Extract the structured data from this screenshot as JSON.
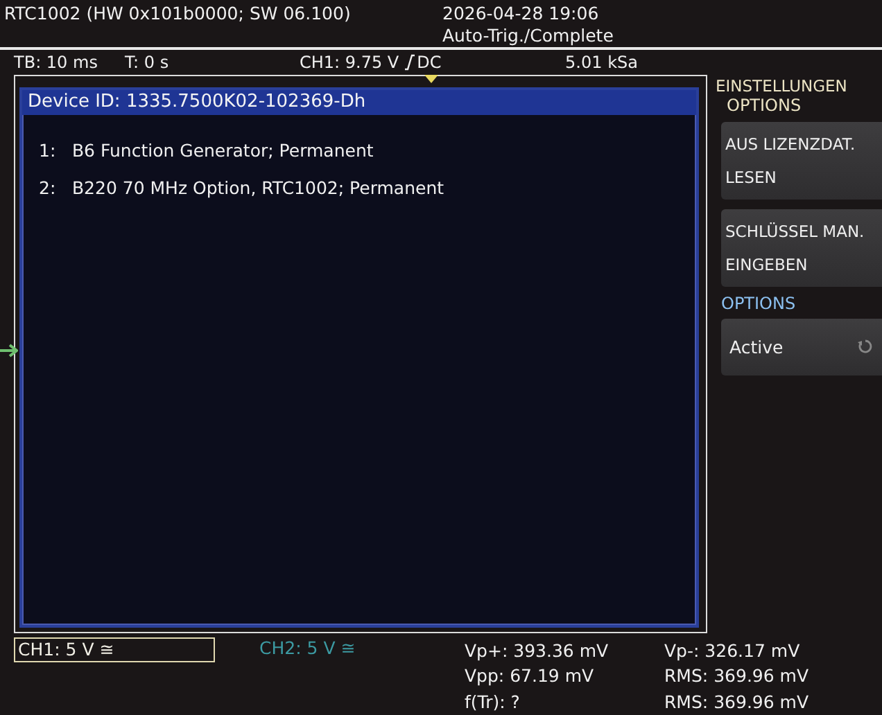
{
  "header": {
    "title": "RTC1002 (HW 0x101b0000; SW 06.100)",
    "datetime": "2026-04-28 19:06",
    "trigger_status": "Auto-Trig./Complete"
  },
  "info_bar": {
    "timebase": "TB: 10 ms",
    "time": "T: 0 s",
    "trigger_level": "CH1: 9.75 V",
    "coupling": "DC",
    "sample_rate": "5.01 kSa"
  },
  "dialog": {
    "title": "Device ID: 1335.7500K02-102369-Dh",
    "items": [
      {
        "number": "1:",
        "text": "B6 Function Generator;  Permanent"
      },
      {
        "number": "2:",
        "text": "B220 70 MHz Option, RTC1002;  Permanent"
      }
    ]
  },
  "side_menu": {
    "title": "EINSTELLUNGEN",
    "subtitle": "OPTIONS",
    "items": [
      {
        "kind": "action",
        "lines": [
          "AUS LIZENZDAT.",
          "LESEN"
        ]
      },
      {
        "kind": "action",
        "lines": [
          "SCHLÜSSEL MAN.",
          "EINGEBEN"
        ]
      },
      {
        "kind": "heading",
        "label": "OPTIONS"
      },
      {
        "kind": "toggle",
        "label": "Active"
      }
    ]
  },
  "channels": [
    {
      "label": "CH1: 5 V ≅",
      "selected": true,
      "color": "#f2f0e6"
    },
    {
      "label": "CH2: 5 V ≅",
      "selected": false,
      "color": "#3c9aa2"
    }
  ],
  "measurements": [
    [
      "Vp+: 393.36 mV",
      "Vpp: 67.19 mV",
      "f(Tr): ?"
    ],
    [
      "Vp-: 326.17 mV",
      "RMS: 369.96 mV",
      "RMS: 369.96 mV"
    ]
  ]
}
